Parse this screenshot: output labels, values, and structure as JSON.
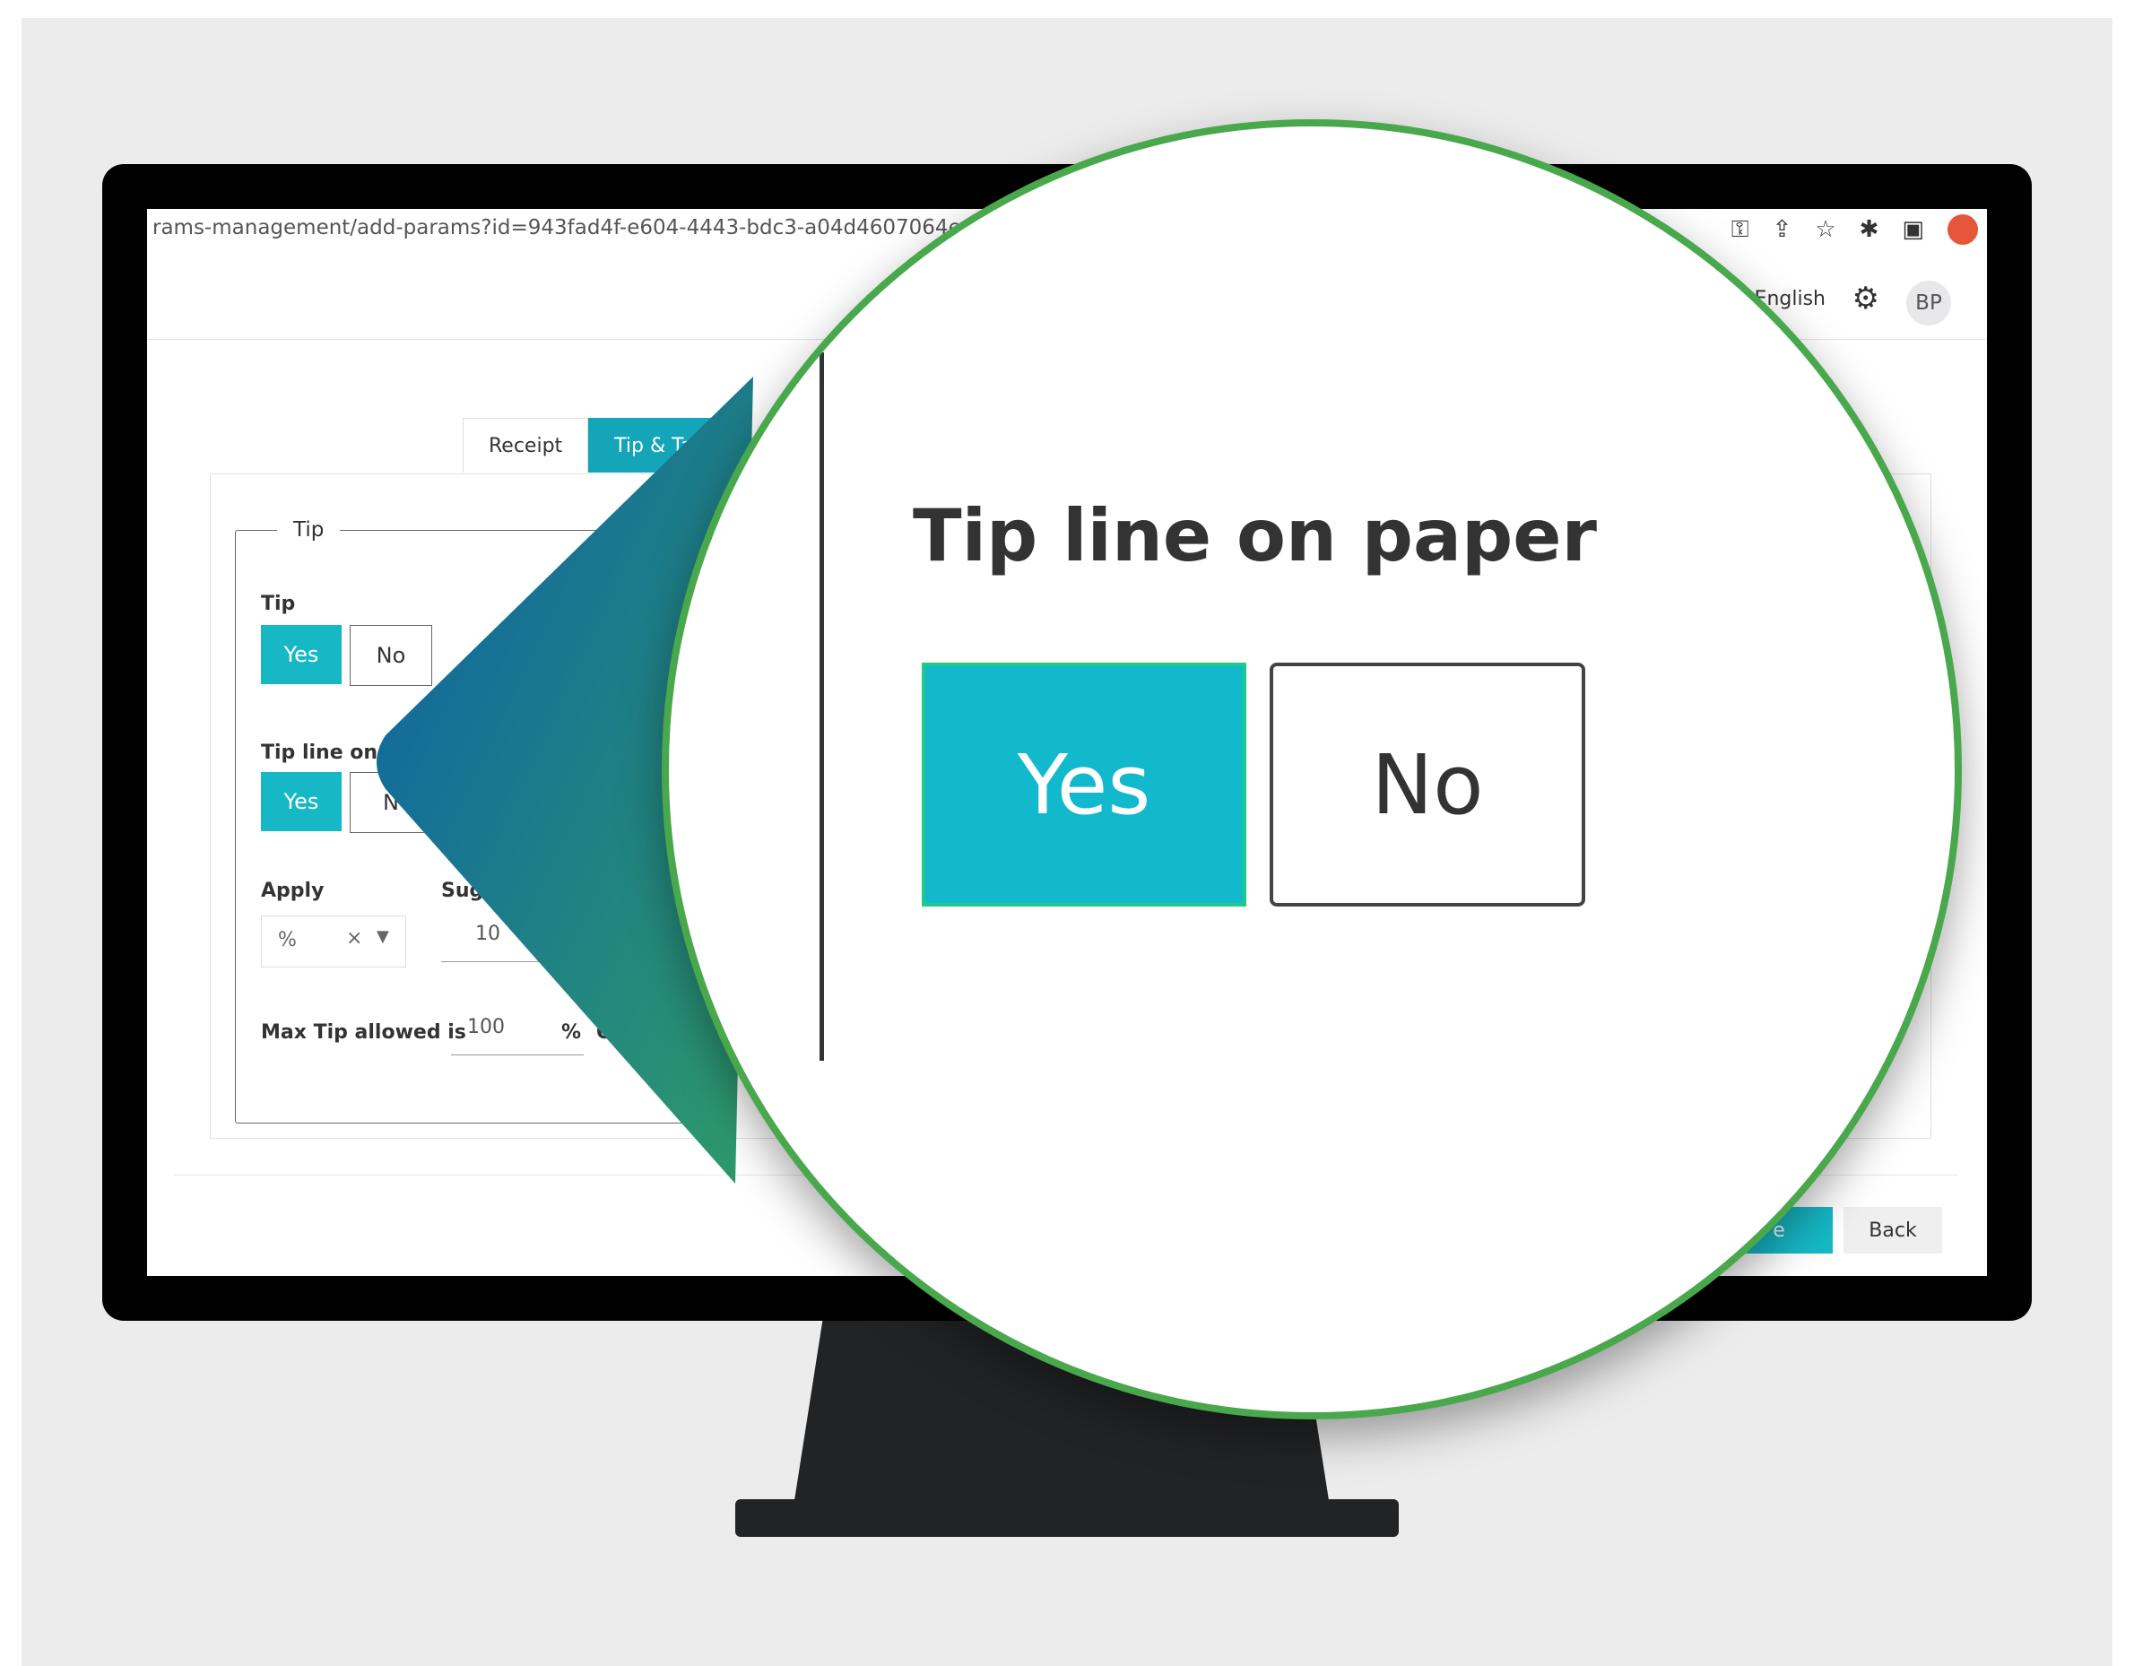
{
  "browser": {
    "url": "rams-management/add-params?id=943fad4f-e604-4443-bdc3-a04d4607064e",
    "icons": [
      "key-icon",
      "share-icon",
      "star-icon",
      "puzzle-icon",
      "sidebar-icon"
    ]
  },
  "header": {
    "language": "English",
    "avatar_initials": "BP"
  },
  "tabs": [
    {
      "label": "Receipt"
    },
    {
      "label": "Tip & Taxe"
    }
  ],
  "tip_section": {
    "legend": "Tip",
    "tip_label": "Tip",
    "tip_line_label": "Tip line on pa",
    "yes": "Yes",
    "no": "No",
    "no_partial": "N",
    "apply_label": "Apply",
    "suggest_label": "Sugg",
    "apply_value": "%",
    "suggest_value": "10",
    "max_tip_label": "Max Tip allowed is",
    "max_tip_value": "100",
    "max_tip_unit": "%",
    "or_label": "Or"
  },
  "footer": {
    "save_partial": "e",
    "back": "Back"
  },
  "zoom": {
    "title": "Tip line on paper",
    "yes": "Yes",
    "no": "No"
  },
  "colors": {
    "accent": "#16b8c6",
    "zoom_ring": "#49a84c",
    "pointer_top": "#0a5fa8",
    "pointer_bottom": "#2f9a6a"
  }
}
